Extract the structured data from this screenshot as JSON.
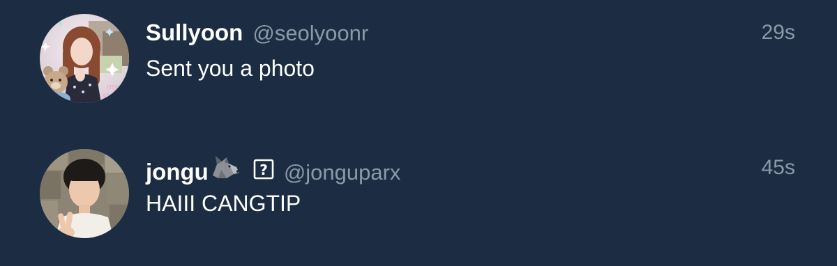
{
  "conversations": [
    {
      "display_name": "Sullyoon",
      "handle": "@seolyoonr",
      "time": "29s",
      "preview": "Sent you a photo",
      "avatar": "profile-photo"
    },
    {
      "display_name": "jongu",
      "name_emoji": "wolf-emoji",
      "name_glyph": "unknown-character-box",
      "handle": "@jonguparx",
      "time": "45s",
      "preview": "HAIII CANGTIP",
      "avatar": "profile-photo"
    }
  ],
  "colors": {
    "background": "#1c2d43",
    "primary_text": "#ffffff",
    "secondary_text": "#8b99a8"
  }
}
